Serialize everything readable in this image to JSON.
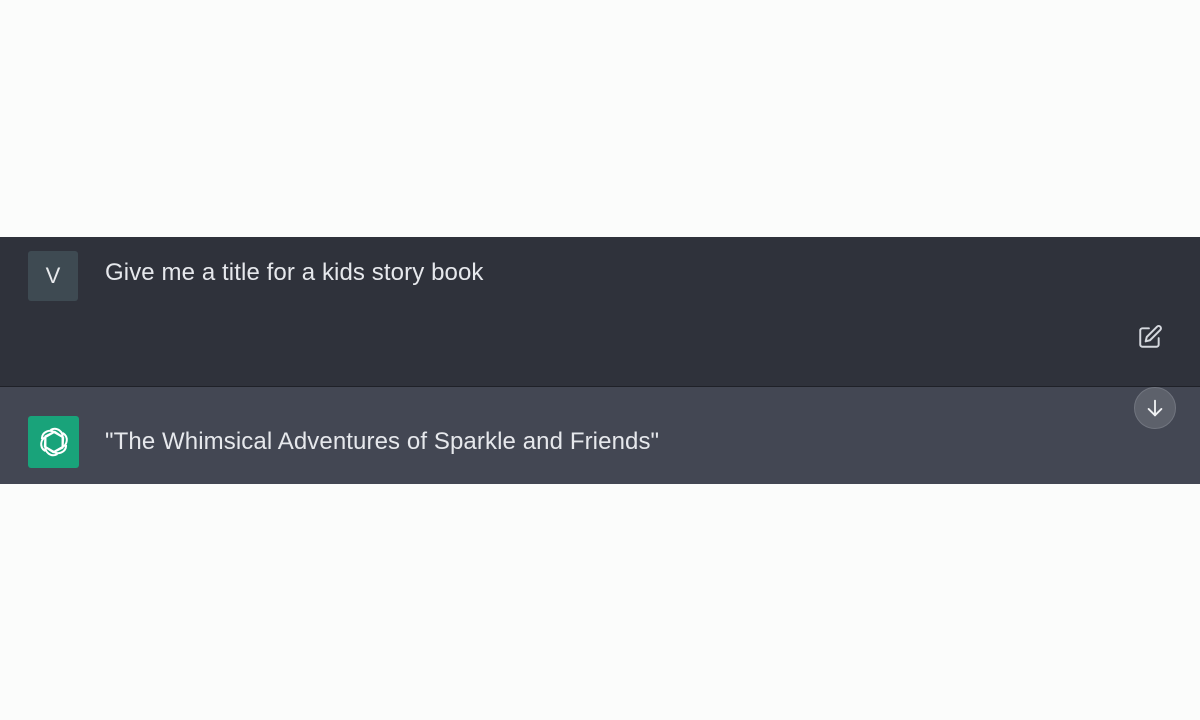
{
  "conversation": {
    "user_message": {
      "avatar_initial": "V",
      "text": "Give me a title for a kids story book"
    },
    "assistant_message": {
      "avatar_icon": "openai-logo-icon",
      "text": "\"The Whimsical Adventures of Sparkle and Friends\""
    }
  },
  "controls": {
    "edit_icon": "edit-icon",
    "scroll_down_icon": "arrow-down-icon"
  },
  "colors": {
    "background": "#fbfcfb",
    "user_row": "#2f323b",
    "assistant_row": "#434753",
    "assistant_avatar": "#19a37a",
    "text": "#e6e8ec"
  }
}
